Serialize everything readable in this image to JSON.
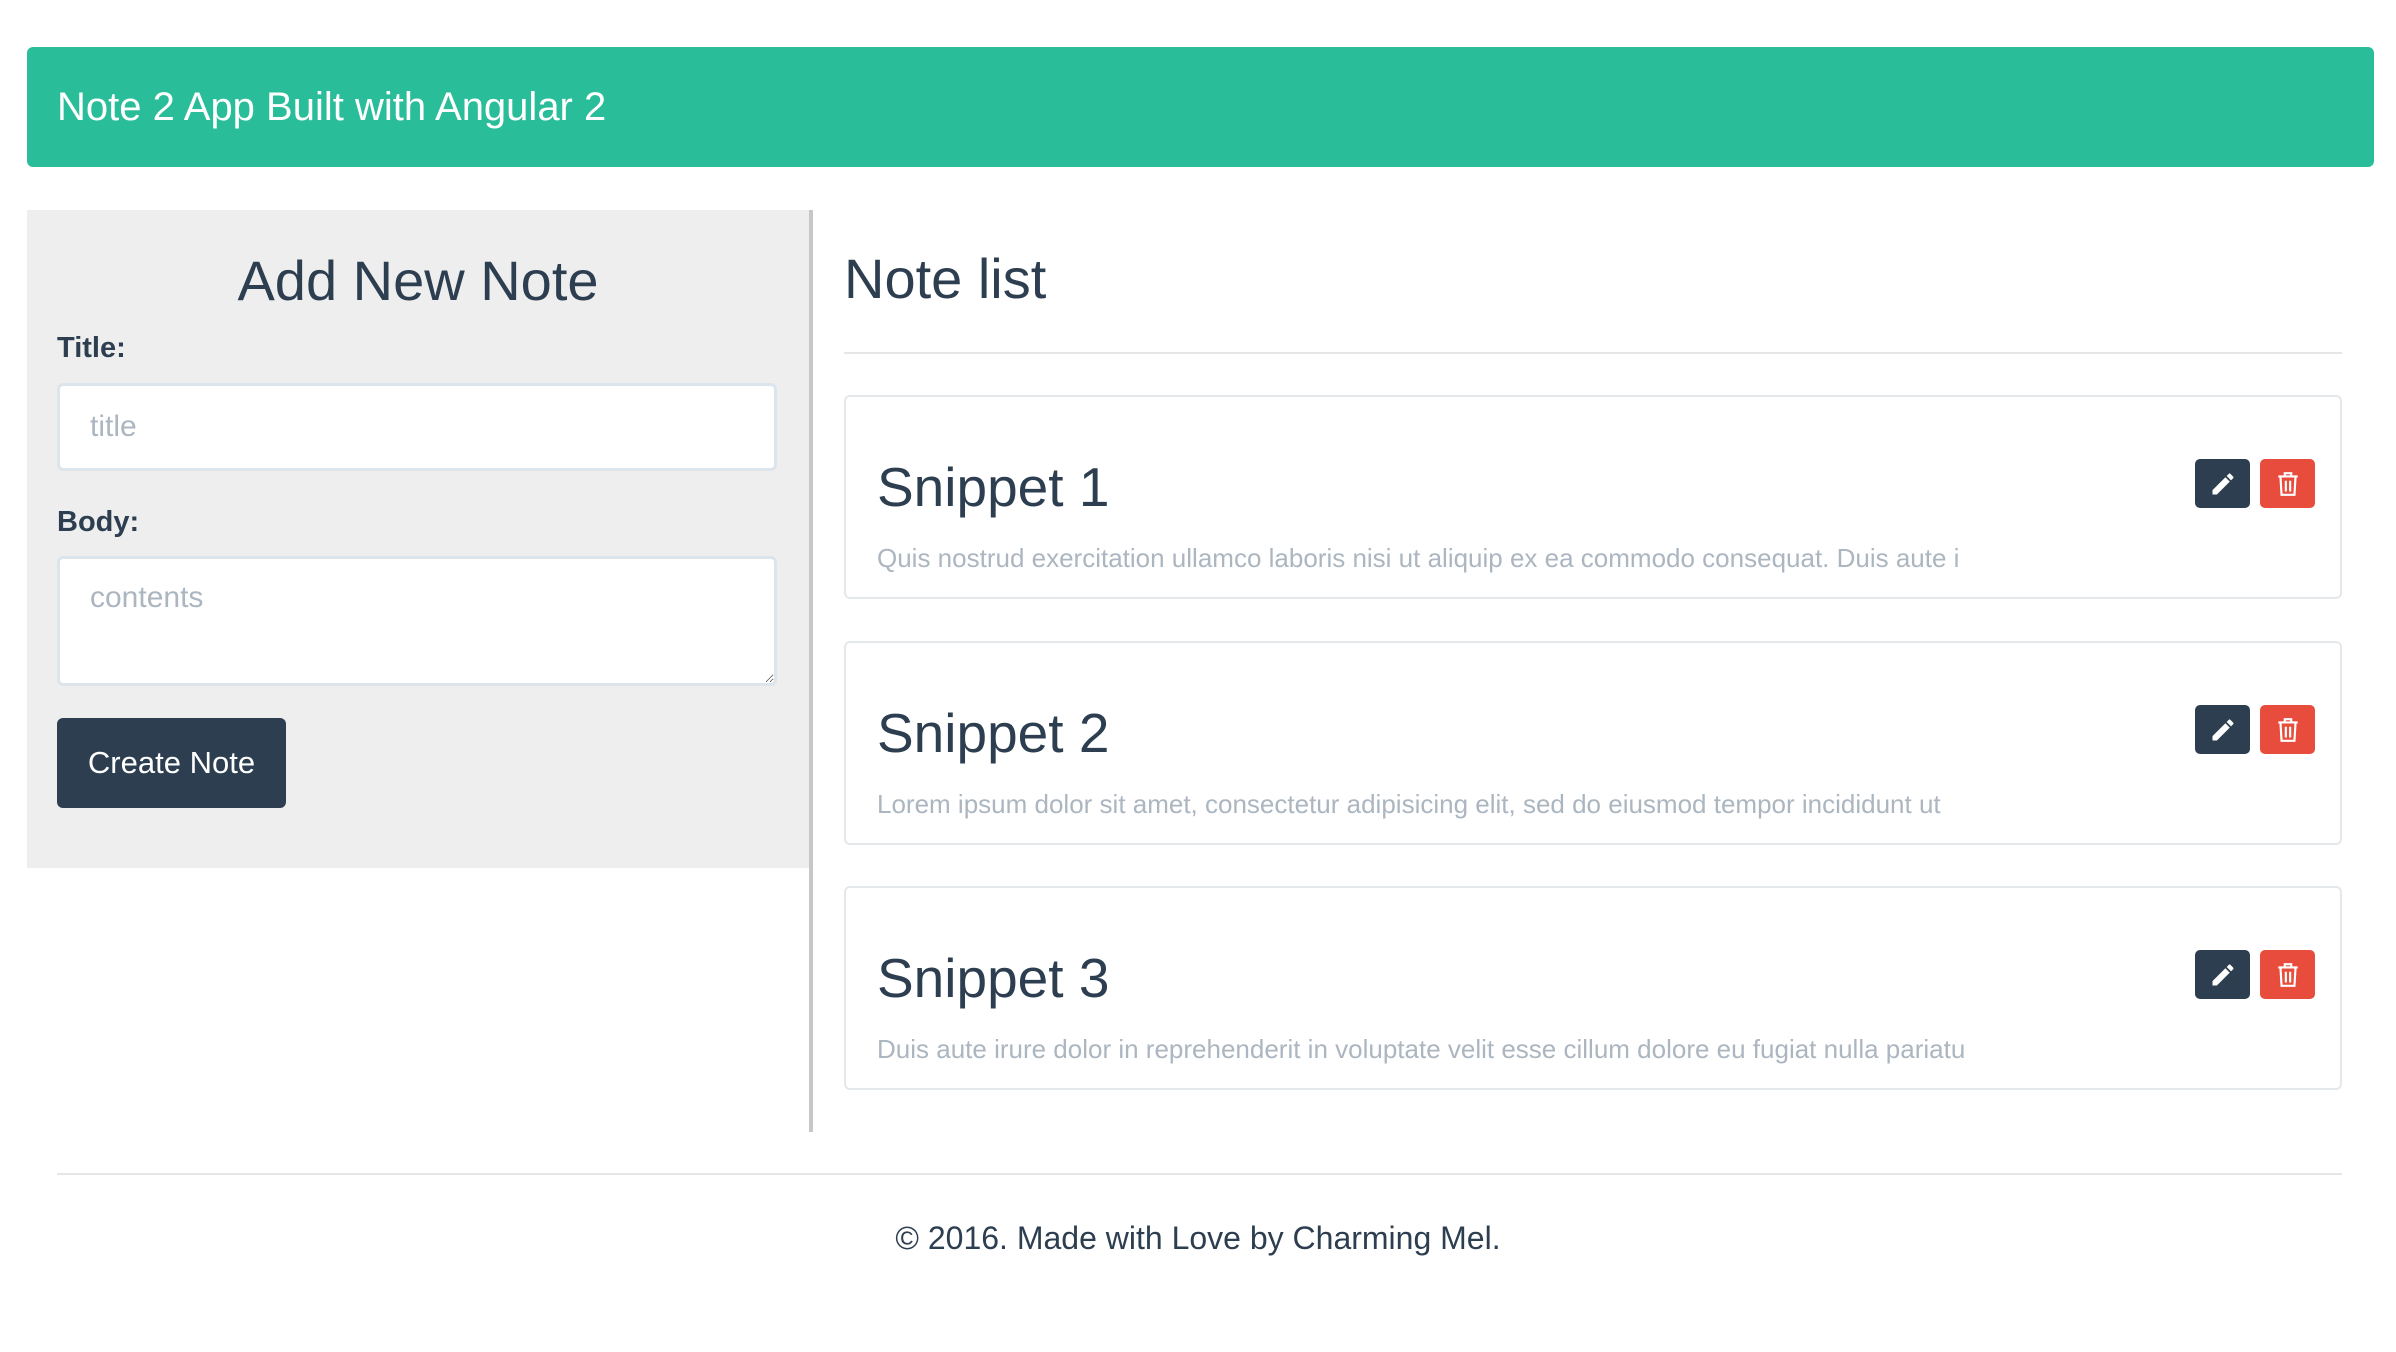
{
  "app": {
    "brand": "Note 2 App Built with Angular 2"
  },
  "colors": {
    "brand": "#2abd9a",
    "primary": "#2c3e50",
    "danger": "#e74c3c"
  },
  "add_form": {
    "heading": "Add New Note",
    "title_label": "Title:",
    "title_placeholder": "title",
    "title_value": "",
    "body_label": "Body:",
    "body_placeholder": "contents",
    "body_value": "",
    "submit_label": "Create Note"
  },
  "note_list": {
    "heading": "Note list",
    "edit_icon": "pencil-icon",
    "delete_icon": "trash-icon",
    "notes": [
      {
        "title": "Snippet 1",
        "body": "Quis nostrud exercitation ullamco laboris nisi ut aliquip ex ea commodo consequat. Duis aute i"
      },
      {
        "title": "Snippet 2",
        "body": "Lorem ipsum dolor sit amet, consectetur adipisicing elit, sed do eiusmod tempor incididunt ut"
      },
      {
        "title": "Snippet 3",
        "body": "Duis aute irure dolor in reprehenderit in voluptate velit esse cillum dolore eu fugiat nulla pariatu"
      }
    ]
  },
  "footer": {
    "text": "© 2016. Made with Love by Charming Mel."
  }
}
